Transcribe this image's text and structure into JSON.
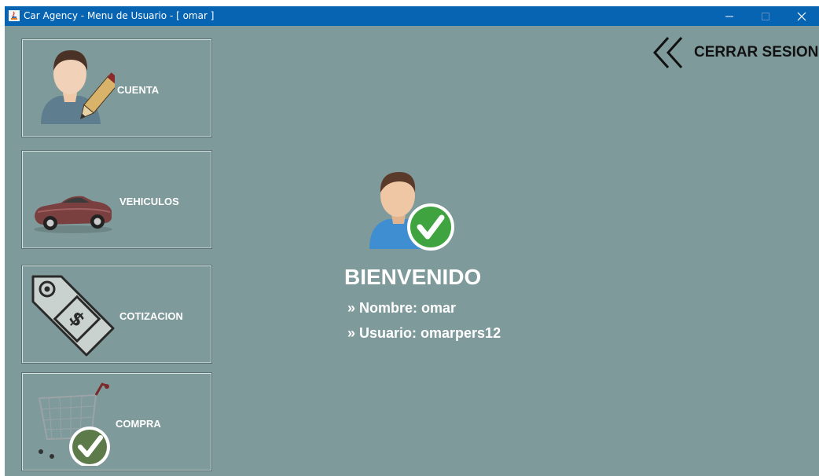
{
  "window": {
    "title": "Car Agency - Menu de Usuario - [ omar ]",
    "controls": [
      "minimize",
      "maximize",
      "close"
    ]
  },
  "menu": {
    "cuenta": {
      "label": "CUENTA",
      "icon": "user-edit-icon"
    },
    "vehiculos": {
      "label": "VEHICULOS",
      "icon": "car-icon"
    },
    "cotizacion": {
      "label": "COTIZACION",
      "icon": "price-tag-icon"
    },
    "compra": {
      "label": "COMPRA",
      "icon": "cart-check-icon"
    }
  },
  "logout": {
    "label": "CERRAR SESION",
    "icon": "double-chevron-left-icon"
  },
  "welcome": {
    "title": "BIENVENIDO",
    "name_line": "» Nombre: omar",
    "user_line": "» Usuario: omarpers12",
    "icon": "user-verified-icon"
  },
  "colors": {
    "titlebar": "#0664b3",
    "background": "#7f9a9b",
    "text": "#ffffff"
  }
}
